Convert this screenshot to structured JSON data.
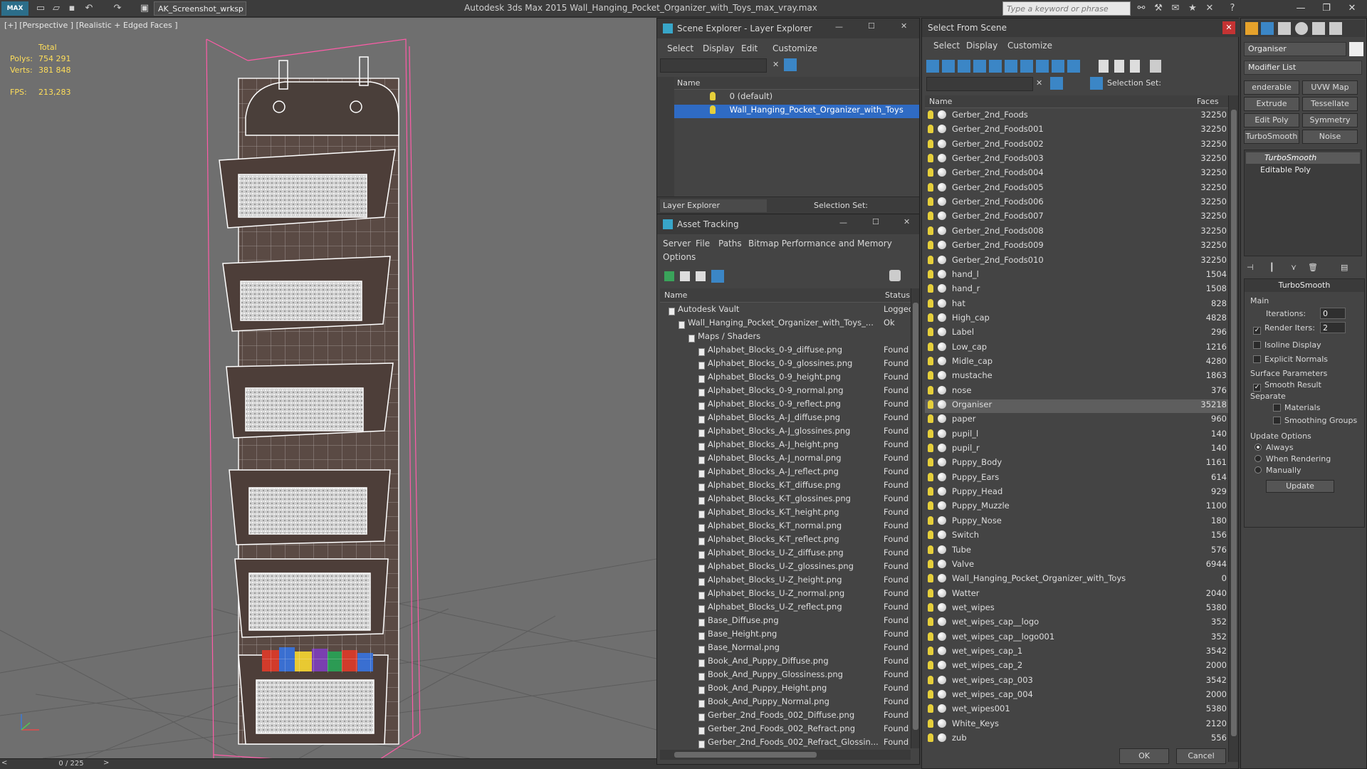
{
  "app": {
    "title": "Autodesk 3ds Max  2015    Wall_Hanging_Pocket_Organizer_with_Toys_max_vray.max",
    "logo": "MAX",
    "workspace": "AK_Screenshot_wrksp",
    "search_placeholder": "Type a keyword or phrase"
  },
  "viewport": {
    "label": "[+] [Perspective ] [Realistic + Edged Faces ]",
    "stats": {
      "total_label": "Total",
      "polys_label": "Polys:",
      "polys_value": "754 291",
      "verts_label": "Verts:",
      "verts_value": "381 848",
      "fps_label": "FPS:",
      "fps_value": "213,283"
    },
    "frame": "0 / 225"
  },
  "scene_explorer": {
    "title": "Scene Explorer - Layer Explorer",
    "menu": [
      "Select",
      "Display",
      "Edit",
      "Customize"
    ],
    "col_name": "Name",
    "layers": [
      "0 (default)",
      "Wall_Hanging_Pocket_Organizer_with_Toys"
    ],
    "footer_left": "Layer Explorer",
    "footer_right": "Selection Set:"
  },
  "asset_tracking": {
    "title": "Asset Tracking",
    "menu": [
      "Server",
      "File",
      "Paths",
      "Bitmap Performance and Memory",
      "Options"
    ],
    "col_name": "Name",
    "col_status": "Status",
    "rows": [
      {
        "name": "Autodesk Vault",
        "status": "Logged",
        "indent": 0
      },
      {
        "name": "Wall_Hanging_Pocket_Organizer_with_Toys_...",
        "status": "Ok",
        "indent": 1
      },
      {
        "name": "Maps / Shaders",
        "status": "",
        "indent": 2
      },
      {
        "name": "Alphabet_Blocks_0-9_diffuse.png",
        "status": "Found",
        "indent": 3
      },
      {
        "name": "Alphabet_Blocks_0-9_glossines.png",
        "status": "Found",
        "indent": 3
      },
      {
        "name": "Alphabet_Blocks_0-9_height.png",
        "status": "Found",
        "indent": 3
      },
      {
        "name": "Alphabet_Blocks_0-9_normal.png",
        "status": "Found",
        "indent": 3
      },
      {
        "name": "Alphabet_Blocks_0-9_reflect.png",
        "status": "Found",
        "indent": 3
      },
      {
        "name": "Alphabet_Blocks_A-J_diffuse.png",
        "status": "Found",
        "indent": 3
      },
      {
        "name": "Alphabet_Blocks_A-J_glossines.png",
        "status": "Found",
        "indent": 3
      },
      {
        "name": "Alphabet_Blocks_A-J_height.png",
        "status": "Found",
        "indent": 3
      },
      {
        "name": "Alphabet_Blocks_A-J_normal.png",
        "status": "Found",
        "indent": 3
      },
      {
        "name": "Alphabet_Blocks_A-J_reflect.png",
        "status": "Found",
        "indent": 3
      },
      {
        "name": "Alphabet_Blocks_K-T_diffuse.png",
        "status": "Found",
        "indent": 3
      },
      {
        "name": "Alphabet_Blocks_K-T_glossines.png",
        "status": "Found",
        "indent": 3
      },
      {
        "name": "Alphabet_Blocks_K-T_height.png",
        "status": "Found",
        "indent": 3
      },
      {
        "name": "Alphabet_Blocks_K-T_normal.png",
        "status": "Found",
        "indent": 3
      },
      {
        "name": "Alphabet_Blocks_K-T_reflect.png",
        "status": "Found",
        "indent": 3
      },
      {
        "name": "Alphabet_Blocks_U-Z_diffuse.png",
        "status": "Found",
        "indent": 3
      },
      {
        "name": "Alphabet_Blocks_U-Z_glossines.png",
        "status": "Found",
        "indent": 3
      },
      {
        "name": "Alphabet_Blocks_U-Z_height.png",
        "status": "Found",
        "indent": 3
      },
      {
        "name": "Alphabet_Blocks_U-Z_normal.png",
        "status": "Found",
        "indent": 3
      },
      {
        "name": "Alphabet_Blocks_U-Z_reflect.png",
        "status": "Found",
        "indent": 3
      },
      {
        "name": "Base_Diffuse.png",
        "status": "Found",
        "indent": 3
      },
      {
        "name": "Base_Height.png",
        "status": "Found",
        "indent": 3
      },
      {
        "name": "Base_Normal.png",
        "status": "Found",
        "indent": 3
      },
      {
        "name": "Book_And_Puppy_Diffuse.png",
        "status": "Found",
        "indent": 3
      },
      {
        "name": "Book_And_Puppy_Glossiness.png",
        "status": "Found",
        "indent": 3
      },
      {
        "name": "Book_And_Puppy_Height.png",
        "status": "Found",
        "indent": 3
      },
      {
        "name": "Book_And_Puppy_Normal.png",
        "status": "Found",
        "indent": 3
      },
      {
        "name": "Gerber_2nd_Foods_002_Diffuse.png",
        "status": "Found",
        "indent": 3
      },
      {
        "name": "Gerber_2nd_Foods_002_Refract.png",
        "status": "Found",
        "indent": 3
      },
      {
        "name": "Gerber_2nd_Foods_002_Refract_Glossin...",
        "status": "Found",
        "indent": 3
      }
    ]
  },
  "select_from_scene": {
    "title": "Select From Scene",
    "menu": [
      "Select",
      "Display",
      "Customize"
    ],
    "selection_set_label": "Selection Set:",
    "col_name": "Name",
    "col_faces": "Faces",
    "rows": [
      {
        "name": "Gerber_2nd_Foods",
        "faces": "32250"
      },
      {
        "name": "Gerber_2nd_Foods001",
        "faces": "32250"
      },
      {
        "name": "Gerber_2nd_Foods002",
        "faces": "32250"
      },
      {
        "name": "Gerber_2nd_Foods003",
        "faces": "32250"
      },
      {
        "name": "Gerber_2nd_Foods004",
        "faces": "32250"
      },
      {
        "name": "Gerber_2nd_Foods005",
        "faces": "32250"
      },
      {
        "name": "Gerber_2nd_Foods006",
        "faces": "32250"
      },
      {
        "name": "Gerber_2nd_Foods007",
        "faces": "32250"
      },
      {
        "name": "Gerber_2nd_Foods008",
        "faces": "32250"
      },
      {
        "name": "Gerber_2nd_Foods009",
        "faces": "32250"
      },
      {
        "name": "Gerber_2nd_Foods010",
        "faces": "32250"
      },
      {
        "name": "hand_l",
        "faces": "1504"
      },
      {
        "name": "hand_r",
        "faces": "1508"
      },
      {
        "name": "hat",
        "faces": "828"
      },
      {
        "name": "High_cap",
        "faces": "4828"
      },
      {
        "name": "Label",
        "faces": "296"
      },
      {
        "name": "Low_cap",
        "faces": "1216"
      },
      {
        "name": "Midle_cap",
        "faces": "4280"
      },
      {
        "name": "mustache",
        "faces": "1863"
      },
      {
        "name": "nose",
        "faces": "376"
      },
      {
        "name": "Organiser",
        "faces": "35218"
      },
      {
        "name": "paper",
        "faces": "960"
      },
      {
        "name": "pupil_l",
        "faces": "140"
      },
      {
        "name": "pupil_r",
        "faces": "140"
      },
      {
        "name": "Puppy_Body",
        "faces": "1161"
      },
      {
        "name": "Puppy_Ears",
        "faces": "614"
      },
      {
        "name": "Puppy_Head",
        "faces": "929"
      },
      {
        "name": "Puppy_Muzzle",
        "faces": "1100"
      },
      {
        "name": "Puppy_Nose",
        "faces": "180"
      },
      {
        "name": "Switch",
        "faces": "156"
      },
      {
        "name": "Tube",
        "faces": "576"
      },
      {
        "name": "Valve",
        "faces": "6944"
      },
      {
        "name": "Wall_Hanging_Pocket_Organizer_with_Toys",
        "faces": "0"
      },
      {
        "name": "Watter",
        "faces": "2040"
      },
      {
        "name": "wet_wipes",
        "faces": "5380"
      },
      {
        "name": "wet_wipes_cap__logo",
        "faces": "352"
      },
      {
        "name": "wet_wipes_cap__logo001",
        "faces": "352"
      },
      {
        "name": "wet_wipes_cap_1",
        "faces": "3542"
      },
      {
        "name": "wet_wipes_cap_2",
        "faces": "2000"
      },
      {
        "name": "wet_wipes_cap_003",
        "faces": "3542"
      },
      {
        "name": "wet_wipes_cap_004",
        "faces": "2000"
      },
      {
        "name": "wet_wipes001",
        "faces": "5380"
      },
      {
        "name": "White_Keys",
        "faces": "2120"
      },
      {
        "name": "zub",
        "faces": "556"
      }
    ],
    "selected_name": "Organiser",
    "ok": "OK",
    "cancel": "Cancel"
  },
  "modify_panel": {
    "object_name": "Organiser",
    "modifier_list": "Modifier List",
    "buttons": [
      "enderable Spli",
      "UVW Map",
      "Extrude",
      "Tessellate",
      "Edit Poly",
      "Symmetry",
      "TurboSmooth",
      "Noise"
    ],
    "stack": [
      "TurboSmooth",
      "Editable Poly"
    ],
    "rollout_title": "TurboSmooth",
    "main_label": "Main",
    "iterations_label": "Iterations:",
    "iterations_value": "0",
    "render_iters_label": "Render Iters:",
    "render_iters_value": "2",
    "isoline_label": "Isoline Display",
    "explicit_normals_label": "Explicit Normals",
    "surface_params_label": "Surface Parameters",
    "smooth_result_label": "Smooth Result",
    "separate_label": "Separate",
    "materials_label": "Materials",
    "smoothing_groups_label": "Smoothing Groups",
    "update_options_label": "Update Options",
    "always_label": "Always",
    "when_rendering_label": "When Rendering",
    "manually_label": "Manually",
    "update_button": "Update"
  },
  "colors": {
    "selection": "#2f6bc4",
    "stats_text": "#ffde5a",
    "wire": "#ffffff",
    "bounding": "#ff5ca8"
  }
}
